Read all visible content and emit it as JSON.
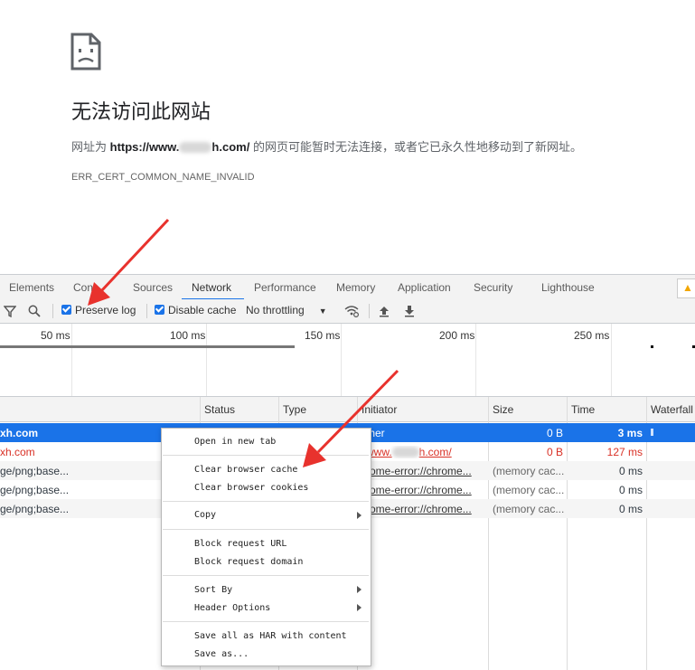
{
  "error_page": {
    "title": "无法访问此网站",
    "desc_prefix": "网址为 ",
    "url_start": "https://www.",
    "url_end": "h.com/",
    "desc_suffix": " 的网页可能暂时无法连接，或者它已永久性地移动到了新网址。",
    "code": "ERR_CERT_COMMON_NAME_INVALID"
  },
  "devtools": {
    "tabs": [
      "Elements",
      "Cons",
      "Sources",
      "Network",
      "Performance",
      "Memory",
      "Application",
      "Security",
      "Lighthouse"
    ],
    "active_tab": "Network",
    "toolbar": {
      "preserve_log": "Preserve log",
      "disable_cache": "Disable cache",
      "throttling": "No throttling"
    },
    "overview_ticks": [
      "50 ms",
      "100 ms",
      "150 ms",
      "200 ms",
      "250 ms"
    ],
    "columns": [
      "Status",
      "Type",
      "Initiator",
      "Size",
      "Time",
      "Waterfall"
    ],
    "rows": [
      {
        "name": "xh.com",
        "initiator": "ther",
        "size": "0 B",
        "time": "3 ms"
      },
      {
        "name": "xh.com",
        "initiator": "www.",
        "initiator_end": "h.com/",
        "size": "0 B",
        "time": "127 ms"
      },
      {
        "name": "ge/png;base...",
        "initiator": "rome-error://chrome...",
        "size": "(memory cac...",
        "time": "0 ms"
      },
      {
        "name": "ge/png;base...",
        "initiator": "rome-error://chrome...",
        "size": "(memory cac...",
        "time": "0 ms"
      },
      {
        "name": "ge/png;base...",
        "initiator": "rome-error://chrome...",
        "size": "(memory cac...",
        "time": "0 ms"
      }
    ]
  },
  "context_menu": {
    "open_new_tab": "Open in new tab",
    "clear_cache": "Clear browser cache",
    "clear_cookies": "Clear browser cookies",
    "copy": "Copy",
    "block_url": "Block request URL",
    "block_domain": "Block request domain",
    "sort_by": "Sort By",
    "header_options": "Header Options",
    "save_har": "Save all as HAR with content",
    "save_as": "Save as..."
  },
  "colors": {
    "accent": "#1a73e8",
    "error_red": "#d93025",
    "annotation_red": "#e8322d"
  }
}
